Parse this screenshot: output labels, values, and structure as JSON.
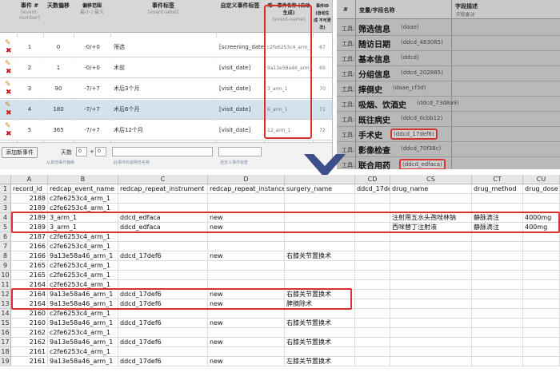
{
  "events": {
    "headers": [
      {
        "title": "事件 #",
        "sub": "[event-number]"
      },
      {
        "title": "天数偏移",
        "sub": ""
      },
      {
        "title": "偏移范围",
        "sub": "最小 / 最大"
      },
      {
        "title": "事件标签",
        "sub": "[event-label]"
      },
      {
        "title": "自定义事件标签",
        "sub": ""
      },
      {
        "title": "唯一事件名称 (自动生成)",
        "sub": "[event-name]"
      },
      {
        "title": "事件ID (自动生成 不可更改)",
        "sub": ""
      }
    ],
    "rows": [
      {
        "num": "1",
        "offset": "0",
        "range": "-0/+0",
        "label": "筛选",
        "custom": "[screening_date]",
        "unique": "c2fe6253c4_arm_1",
        "id": "67"
      },
      {
        "num": "2",
        "offset": "1",
        "range": "-0/+0",
        "label": "术前",
        "custom": "[visit_date]",
        "unique": "9a13e58a46_arm_1",
        "id": "69"
      },
      {
        "num": "3",
        "offset": "90",
        "range": "-7/+7",
        "label": "术后3个月",
        "custom": "[visit_date]",
        "unique": "3_arm_1",
        "id": "70"
      },
      {
        "num": "4",
        "offset": "180",
        "range": "-7/+7",
        "label": "术后6个月",
        "custom": "[visit_date]",
        "unique": "6_arm_1",
        "id": "71"
      },
      {
        "num": "5",
        "offset": "365",
        "range": "-7/+7",
        "label": "术后12个月",
        "custom": "[visit_date]",
        "unique": "12_arm_1",
        "id": "72"
      }
    ],
    "footer": {
      "add_button": "添加新事件",
      "days_label": "天数",
      "days_value": "0",
      "plus_label": "+",
      "plus_value": "0",
      "hint1": "从其他事件偏移",
      "hint2": "此事件的说明性名称",
      "hint3": "自定义事件标签"
    }
  },
  "vars": {
    "header": {
      "hash": "#",
      "col1": "变量/字段名称",
      "col2": "字段描述",
      "col2_sub": "字段备注"
    },
    "rows": [
      {
        "lbl": "工具:",
        "name": "筛选信息",
        "code": "(daae)"
      },
      {
        "lbl": "工具:",
        "name": "随访日期",
        "code": "(ddcd_483085)"
      },
      {
        "lbl": "工具:",
        "name": "基本信息",
        "code": "(ddcd)"
      },
      {
        "lbl": "工具:",
        "name": "分组信息",
        "code": "(ddcd_202885)"
      },
      {
        "lbl": "工具:",
        "name": "摔倒史",
        "code": "(daae_cf3d)"
      },
      {
        "lbl": "工具:",
        "name": "吸烟、饮酒史",
        "code": "(ddcd_73d8a9)"
      },
      {
        "lbl": "工具:",
        "name": "既往病史",
        "code": "(ddcd_0cbb12)"
      },
      {
        "lbl": "工具:",
        "name": "手术史",
        "code": "(ddcd_17def6)"
      },
      {
        "lbl": "工具:",
        "name": "影像检查",
        "code": "(ddcd_70f38c)"
      },
      {
        "lbl": "工具:",
        "name": "联合用药",
        "code": "(ddcd_edfaca)"
      }
    ]
  },
  "sheet": {
    "col_letters": [
      "",
      "A",
      "B",
      "C",
      "D",
      "",
      "CD",
      "CS",
      "CT",
      "CU"
    ],
    "headers": [
      "record_id",
      "redcap_event_name",
      "redcap_repeat_instrument",
      "redcap_repeat_instance",
      "surgery_name",
      "ddcd_17de",
      "drug_name",
      "drug_method",
      "drug_dose"
    ],
    "rows": [
      {
        "n": "1",
        "cells": [
          "record_id",
          "redcap_event_name",
          "redcap_repeat_instrument",
          "redcap_repeat_instance",
          "surgery_name",
          "ddcd_17de",
          "drug_name",
          "drug_method",
          "drug_dose"
        ]
      },
      {
        "n": "2",
        "cells": [
          "2188",
          "c2fe6253c4_arm_1",
          "",
          "",
          "",
          "",
          "",
          "",
          ""
        ]
      },
      {
        "n": "3",
        "cells": [
          "2189",
          "c2fe6253c4_arm_1",
          "",
          "",
          "",
          "",
          "",
          "",
          ""
        ]
      },
      {
        "n": "4",
        "cells": [
          "2189",
          "3_arm_1",
          "ddcd_edfaca",
          "new",
          "",
          "",
          "注射用五水头孢唑林钠",
          "静脉滴注",
          "4000mg"
        ]
      },
      {
        "n": "5",
        "cells": [
          "2189",
          "3_arm_1",
          "ddcd_edfaca",
          "new",
          "",
          "",
          "西咪替丁注射液",
          "静脉滴注",
          "400mg"
        ]
      },
      {
        "n": "6",
        "cells": [
          "2187",
          "c2fe6253c4_arm_1",
          "",
          "",
          "",
          "",
          "",
          "",
          ""
        ]
      },
      {
        "n": "7",
        "cells": [
          "2166",
          "c2fe6253c4_arm_1",
          "",
          "",
          "",
          "",
          "",
          "",
          ""
        ]
      },
      {
        "n": "8",
        "cells": [
          "2166",
          "9a13e58a46_arm_1",
          "ddcd_17def6",
          "new",
          "右膝关节置换术",
          "",
          "",
          "",
          ""
        ]
      },
      {
        "n": "9",
        "cells": [
          "2165",
          "c2fe6253c4_arm_1",
          "",
          "",
          "",
          "",
          "",
          "",
          ""
        ]
      },
      {
        "n": "10",
        "cells": [
          "2165",
          "c2fe6253c4_arm_1",
          "",
          "",
          "",
          "",
          "",
          "",
          ""
        ]
      },
      {
        "n": "11",
        "cells": [
          "2164",
          "c2fe6253c4_arm_1",
          "",
          "",
          "",
          "",
          "",
          "",
          ""
        ]
      },
      {
        "n": "12",
        "cells": [
          "2164",
          "9a13e58a46_arm_1",
          "ddcd_17def6",
          "new",
          "右膝关节置换术",
          "",
          "",
          "",
          ""
        ]
      },
      {
        "n": "13",
        "cells": [
          "2164",
          "9a13e58a46_arm_1",
          "ddcd_17def6",
          "new",
          "脾摘除术",
          "",
          "",
          "",
          ""
        ]
      },
      {
        "n": "14",
        "cells": [
          "2160",
          "c2fe6253c4_arm_1",
          "",
          "",
          "",
          "",
          "",
          "",
          ""
        ]
      },
      {
        "n": "15",
        "cells": [
          "2160",
          "9a13e58a46_arm_1",
          "ddcd_17def6",
          "new",
          "右膝关节置换术",
          "",
          "",
          "",
          ""
        ]
      },
      {
        "n": "16",
        "cells": [
          "2162",
          "c2fe6253c4_arm_1",
          "",
          "",
          "",
          "",
          "",
          "",
          ""
        ]
      },
      {
        "n": "17",
        "cells": [
          "2162",
          "9a13e58a46_arm_1",
          "ddcd_17def6",
          "new",
          "右膝关节置换术",
          "",
          "",
          "",
          ""
        ]
      },
      {
        "n": "18",
        "cells": [
          "2161",
          "c2fe6253c4_arm_1",
          "",
          "",
          "",
          "",
          "",
          "",
          ""
        ]
      },
      {
        "n": "19",
        "cells": [
          "2161",
          "9a13e58a46_arm_1",
          "ddcd_17def6",
          "new",
          "左膝关节置换术",
          "",
          "",
          "",
          ""
        ]
      }
    ]
  },
  "colors": {
    "highlight": "#d9322c",
    "arrow": "#3d4f8a",
    "selected_row": "#d3e3ee"
  }
}
